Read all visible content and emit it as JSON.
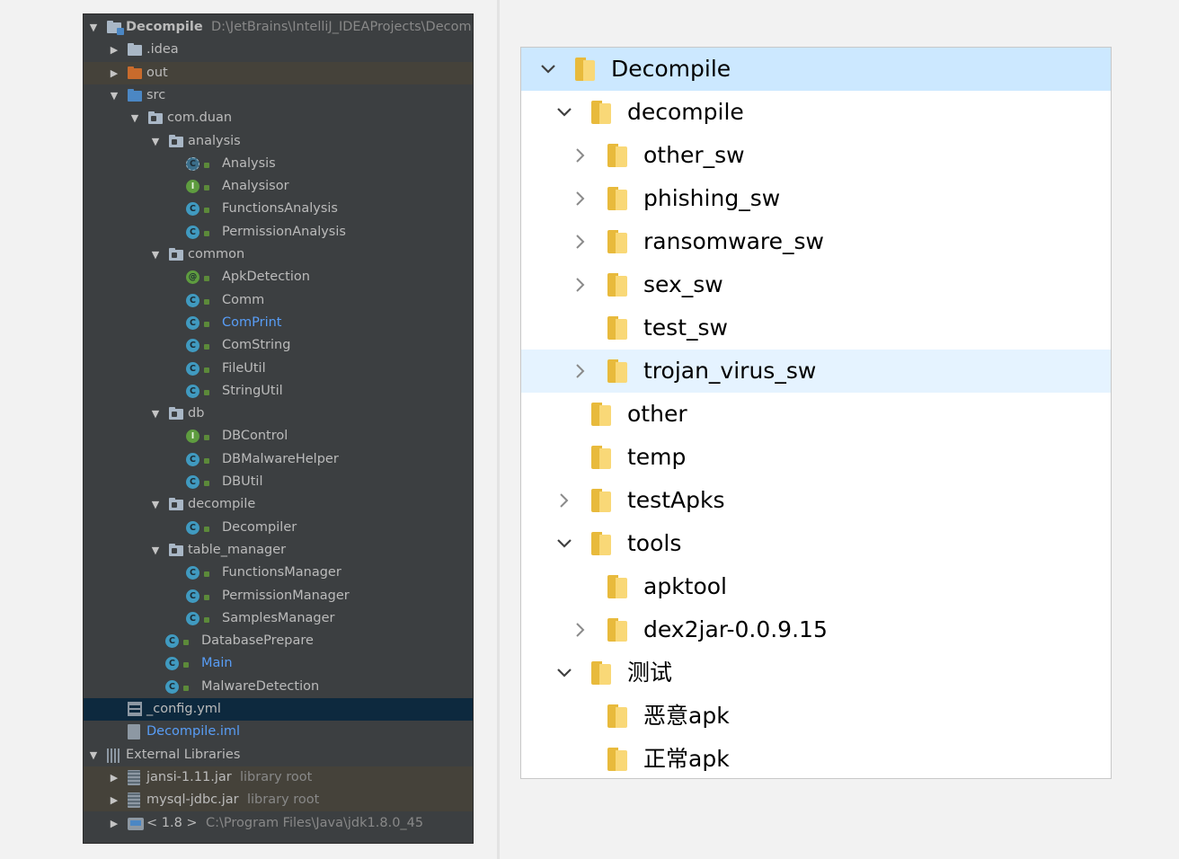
{
  "ide_tree": [
    {
      "label": "Decompile",
      "hint": "D:\\JetBrains\\IntelliJ_IDEAProjects\\Decomp",
      "icon": "project-folder-icon",
      "expanded": true
    },
    {
      "label": ".idea",
      "icon": "folder-icon",
      "expanded": false
    },
    {
      "label": "out",
      "icon": "excluded-folder-icon",
      "expanded": false
    },
    {
      "label": "src",
      "icon": "source-folder-icon",
      "expanded": true
    },
    {
      "label": "com.duan",
      "icon": "package-icon",
      "expanded": true
    },
    {
      "label": "analysis",
      "icon": "package-icon",
      "expanded": true
    },
    {
      "label": "Analysis",
      "icon": "abstract-class-icon"
    },
    {
      "label": "Analysisor",
      "icon": "interface-icon"
    },
    {
      "label": "FunctionsAnalysis",
      "icon": "class-icon"
    },
    {
      "label": "PermissionAnalysis",
      "icon": "class-icon"
    },
    {
      "label": "common",
      "icon": "package-icon",
      "expanded": true
    },
    {
      "label": "ApkDetection",
      "icon": "annotation-icon"
    },
    {
      "label": "Comm",
      "icon": "class-icon"
    },
    {
      "label": "ComPrint",
      "icon": "class-icon",
      "color": "#589df6"
    },
    {
      "label": "ComString",
      "icon": "class-icon"
    },
    {
      "label": "FileUtil",
      "icon": "class-icon"
    },
    {
      "label": "StringUtil",
      "icon": "class-icon"
    },
    {
      "label": "db",
      "icon": "package-icon",
      "expanded": true
    },
    {
      "label": "DBControl",
      "icon": "interface-icon"
    },
    {
      "label": "DBMalwareHelper",
      "icon": "class-icon"
    },
    {
      "label": "DBUtil",
      "icon": "class-icon"
    },
    {
      "label": "decompile",
      "icon": "package-icon",
      "expanded": true
    },
    {
      "label": "Decompiler",
      "icon": "class-icon"
    },
    {
      "label": "table_manager",
      "icon": "package-icon",
      "expanded": true
    },
    {
      "label": "FunctionsManager",
      "icon": "class-icon"
    },
    {
      "label": "PermissionManager",
      "icon": "class-icon"
    },
    {
      "label": "SamplesManager",
      "icon": "class-icon"
    },
    {
      "label": "DatabasePrepare",
      "icon": "class-icon"
    },
    {
      "label": "Main",
      "icon": "class-icon",
      "color": "#589df6"
    },
    {
      "label": "MalwareDetection",
      "icon": "class-icon"
    },
    {
      "label": "_config.yml",
      "icon": "yml-file-icon"
    },
    {
      "label": "Decompile.iml",
      "icon": "iml-file-icon",
      "color": "#589df6"
    },
    {
      "label": "External Libraries",
      "icon": "libraries-icon",
      "expanded": true
    },
    {
      "label": "jansi-1.11.jar",
      "hint": "library root",
      "icon": "jar-icon",
      "expanded": false
    },
    {
      "label": "mysql-jdbc.jar",
      "hint": "library root",
      "icon": "jar-icon",
      "expanded": false
    },
    {
      "label": "< 1.8 >",
      "hint": "C:\\Program Files\\Java\\jdk1.8.0_45",
      "icon": "jdk-icon",
      "expanded": false
    }
  ],
  "explorer_tree": [
    {
      "label": "Decompile",
      "expanded": true
    },
    {
      "label": "decompile",
      "expanded": true
    },
    {
      "label": "other_sw",
      "expanded": false
    },
    {
      "label": "phishing_sw",
      "expanded": false
    },
    {
      "label": "ransomware_sw",
      "expanded": false
    },
    {
      "label": "sex_sw",
      "expanded": false
    },
    {
      "label": "test_sw"
    },
    {
      "label": "trojan_virus_sw",
      "expanded": false
    },
    {
      "label": "other"
    },
    {
      "label": "temp"
    },
    {
      "label": "testApks",
      "expanded": false
    },
    {
      "label": "tools",
      "expanded": true
    },
    {
      "label": "apktool"
    },
    {
      "label": "dex2jar-0.0.9.15",
      "expanded": false
    },
    {
      "label": "测试",
      "expanded": true
    },
    {
      "label": "恶意apk"
    },
    {
      "label": "正常apk"
    }
  ]
}
